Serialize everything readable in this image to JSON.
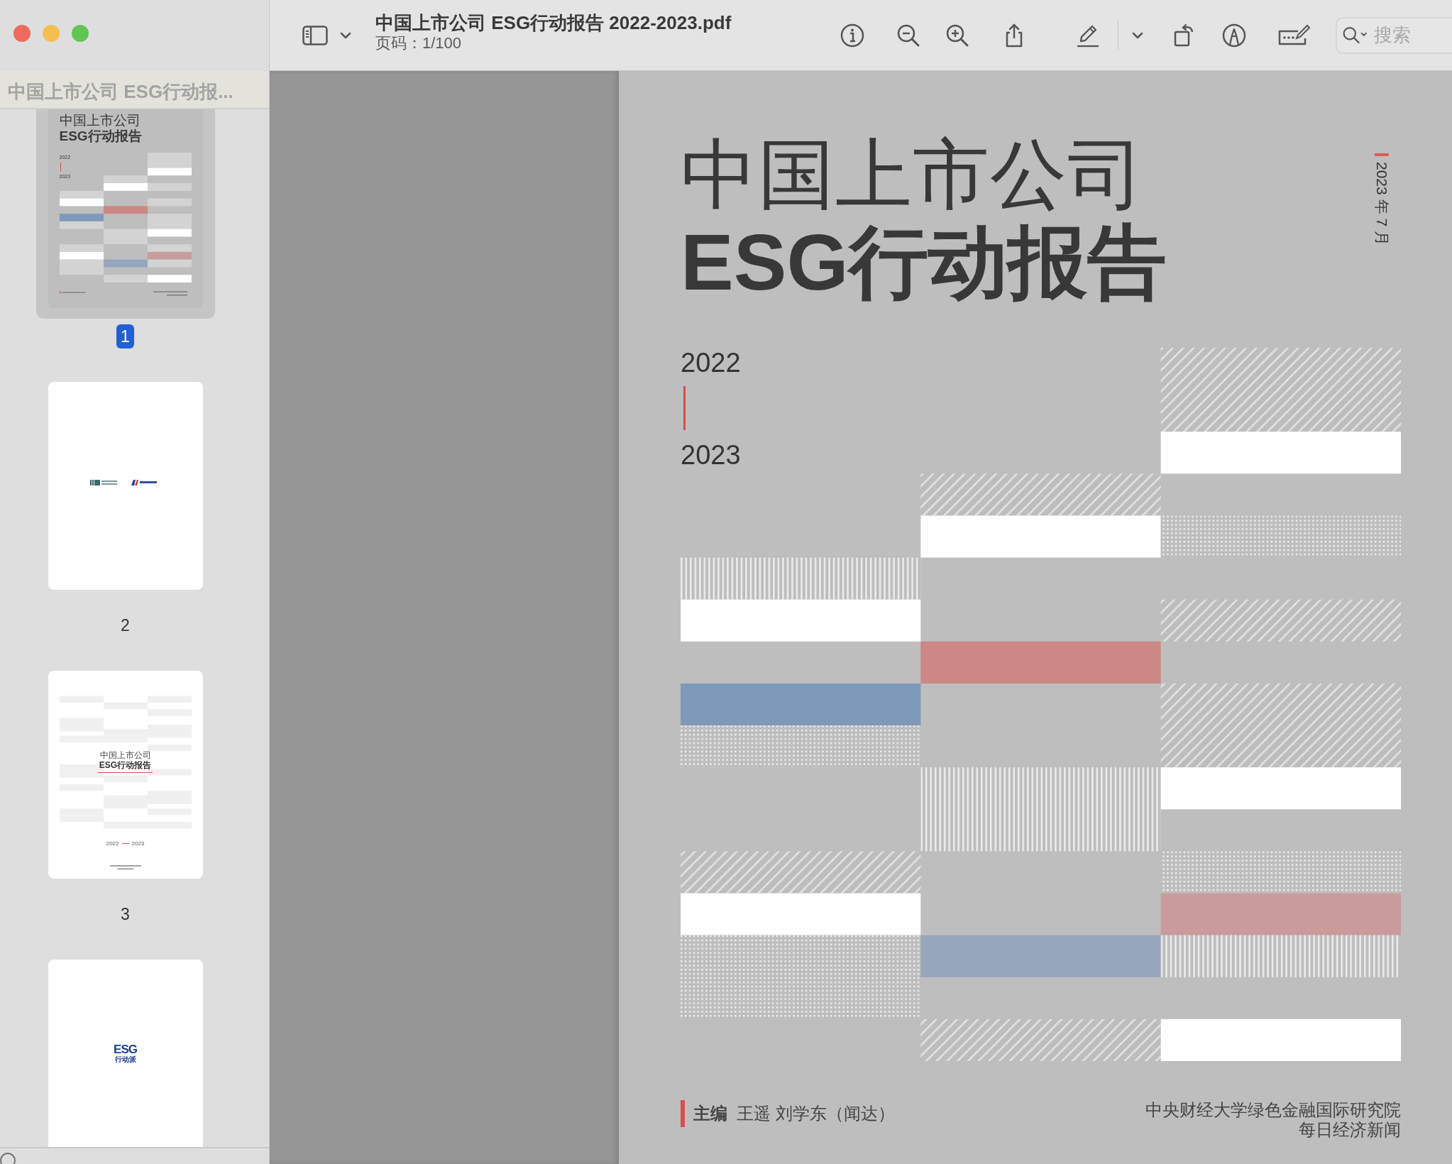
{
  "toolbar": {
    "title": "中国上市公司 ESG行动报告 2022-2023.pdf",
    "subtitle": "页码：1/100",
    "search": {
      "placeholder": "搜索"
    }
  },
  "sidebar": {
    "title": "中国上市公司 ESG行动报...",
    "thumbnails": [
      {
        "kind": "cover",
        "label": "1",
        "selected": true,
        "title_lines": [
          "中国上市公司",
          "ESG行动报告"
        ],
        "years": [
          "2022",
          "2023"
        ]
      },
      {
        "kind": "logos",
        "label": "2",
        "selected": false
      },
      {
        "kind": "title-page",
        "label": "3",
        "selected": false,
        "title_lines": [
          "中国上市公司",
          "ESG行动报告"
        ],
        "years": [
          "2022",
          "2023"
        ]
      },
      {
        "kind": "emblem",
        "selected": false,
        "mark": "ESG",
        "caption": "行动派"
      }
    ]
  },
  "page": {
    "title_lines": [
      "中国上市公司",
      "ESG行动报告"
    ],
    "years": [
      "2022",
      "2023"
    ],
    "date": "2023 年 7 月",
    "editors": "**主编**  王遥 刘学东（闻达）",
    "publishers": [
      "中央财经大学绿色金融国际研究院",
      "每日经济新闻"
    ]
  }
}
